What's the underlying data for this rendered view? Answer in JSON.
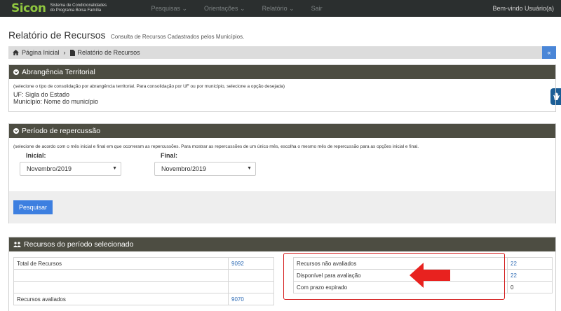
{
  "topbar": {
    "logo_text": "Sicon",
    "logo_sub_line1": "Sistema de Condicionalidades",
    "logo_sub_line2": "do Programa Bolsa Família",
    "nav": [
      {
        "label": "Pesquisas ⌄"
      },
      {
        "label": "Orientações ⌄"
      },
      {
        "label": "Relatório ⌄"
      },
      {
        "label": "Sair"
      }
    ],
    "welcome": "Bem-vindo Usuário(a)"
  },
  "page": {
    "title": "Relatório de Recursos",
    "subtitle": "Consulta de Recursos Cadastrados pelos Municípios."
  },
  "breadcrumb": {
    "home": "Página Inicial",
    "current": "Relatório de Recursos",
    "collapse": "«"
  },
  "abrangencia": {
    "title": "Abrangência Territorial",
    "hint": "(selecione o tipo de consolidação por abrangência territorial. Para consolidação por UF ou por município, selecione a opção desejada)",
    "uf_line": "UF: Sigla do Estado",
    "municipio_line": "Município: Nome do município"
  },
  "periodo": {
    "title": "Período de repercussão",
    "hint": "(selecione de acordo com o mês inicial e final em que ocorreram as repercussões. Para mostrar as repercussões de um único mês, escolha o mesmo mês de repercussão para as opções inicial e final.",
    "inicial_label": "Inicial:",
    "inicial_value": "Novembro/2019",
    "final_label": "Final:",
    "final_value": "Novembro/2019",
    "button": "Pesquisar"
  },
  "recursos": {
    "title": "Recursos do período selecionado",
    "left_rows": [
      {
        "label": "Total de Recursos",
        "value": "9092"
      },
      {
        "label": "",
        "value": ""
      },
      {
        "label": "",
        "value": ""
      },
      {
        "label": "Recursos avaliados",
        "value": "9070"
      }
    ],
    "right_rows": [
      {
        "label": "Recursos não avaliados",
        "value": "22"
      },
      {
        "label": "Disponível para avaliação",
        "value": "22"
      },
      {
        "label": "Com prazo expirado",
        "value": "0"
      }
    ]
  },
  "colors": {
    "topbar": "#2b2f2f",
    "logo": "#8fc63f",
    "panel_header": "#4d4d42",
    "button": "#3d7fe0",
    "highlight": "#d42020",
    "link_value": "#2d6bb5"
  }
}
